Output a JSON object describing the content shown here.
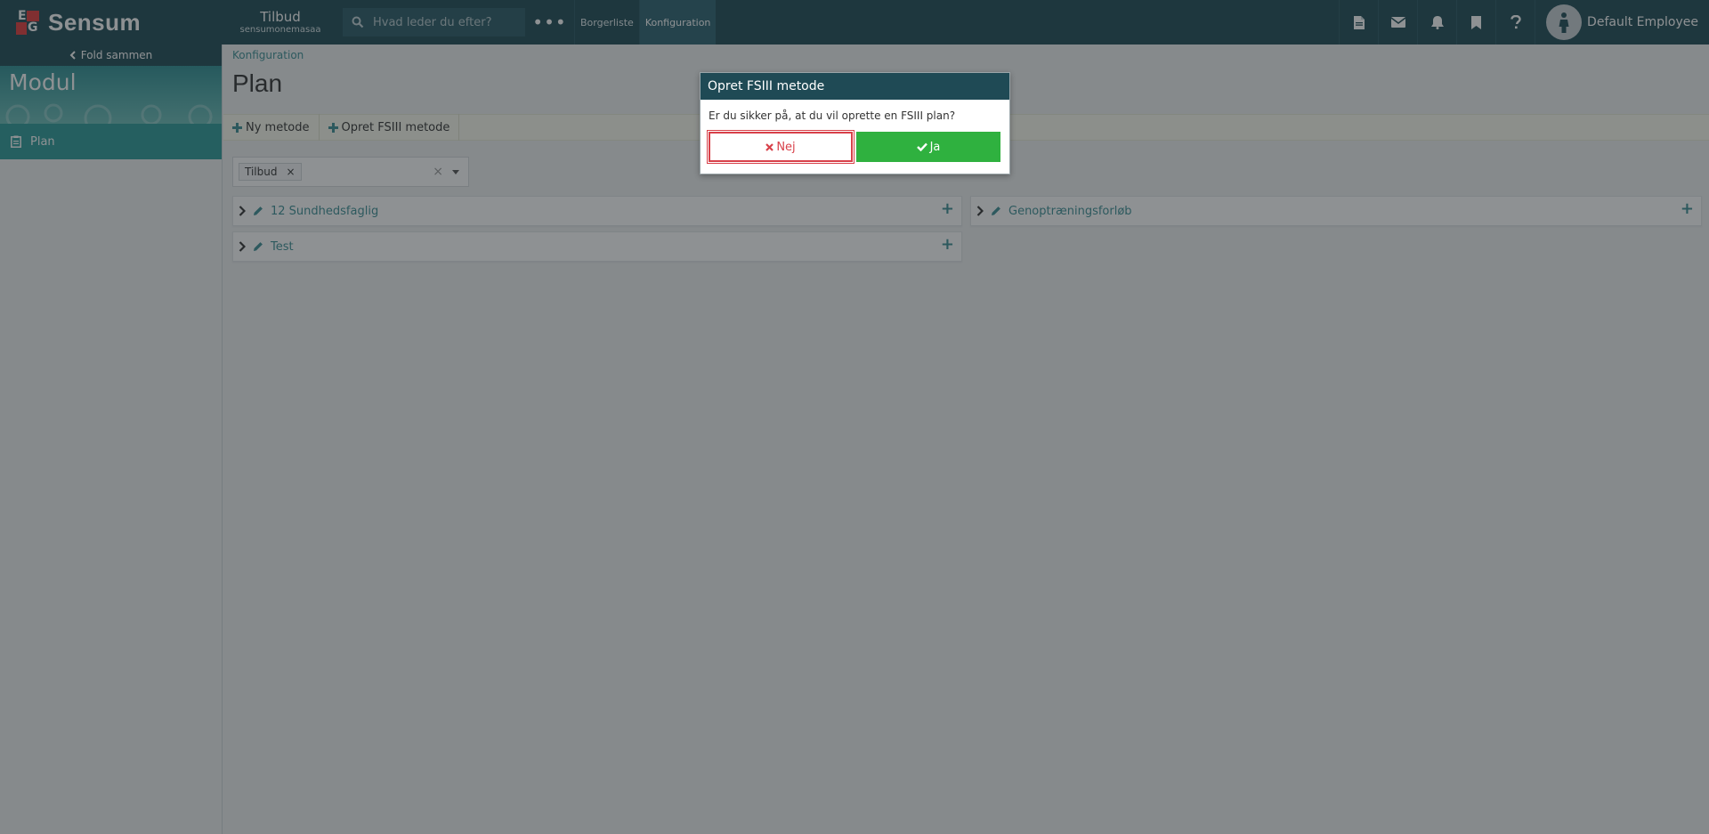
{
  "topbar": {
    "brand": "Sensum",
    "logo_letters": "EG",
    "tenant_title": "Tilbud",
    "tenant_subtitle": "sensumonemasaa",
    "search_placeholder": "Hvad leder du efter?",
    "more_label": "•••",
    "nav": [
      {
        "label": "Borgerliste"
      },
      {
        "label": "Konfiguration",
        "active": true
      }
    ],
    "icons": [
      "document-icon",
      "mail-icon",
      "bell-icon",
      "bookmark-icon",
      "help-icon"
    ],
    "user_name": "Default Employee"
  },
  "sidebar": {
    "fold_label": "Fold sammen",
    "module_title": "Modul",
    "items": [
      {
        "label": "Plan",
        "icon": "clipboard-icon"
      }
    ]
  },
  "main": {
    "breadcrumb": "Konfiguration",
    "title": "Plan",
    "toolbar": {
      "new_method": "Ny metode",
      "create_fsiii": "Opret FSIII metode"
    },
    "filter": {
      "tag": "Tilbud",
      "tag_remove": "×",
      "clear": "×"
    },
    "plans_left": [
      {
        "label": "12 Sundhedsfaglig"
      },
      {
        "label": "Test"
      }
    ],
    "plans_right": [
      {
        "label": "Genoptræningsforløb"
      }
    ]
  },
  "dialog": {
    "title": "Opret FSIII metode",
    "message": "Er du sikker på, at du vil oprette en FSIII plan?",
    "no_label": "Nej",
    "yes_label": "Ja"
  },
  "colors": {
    "header": "#1f4a55",
    "accent": "#3c8f95",
    "sidebar_active": "#2c9a98",
    "danger": "#d8414a",
    "success": "#2fb13f"
  }
}
